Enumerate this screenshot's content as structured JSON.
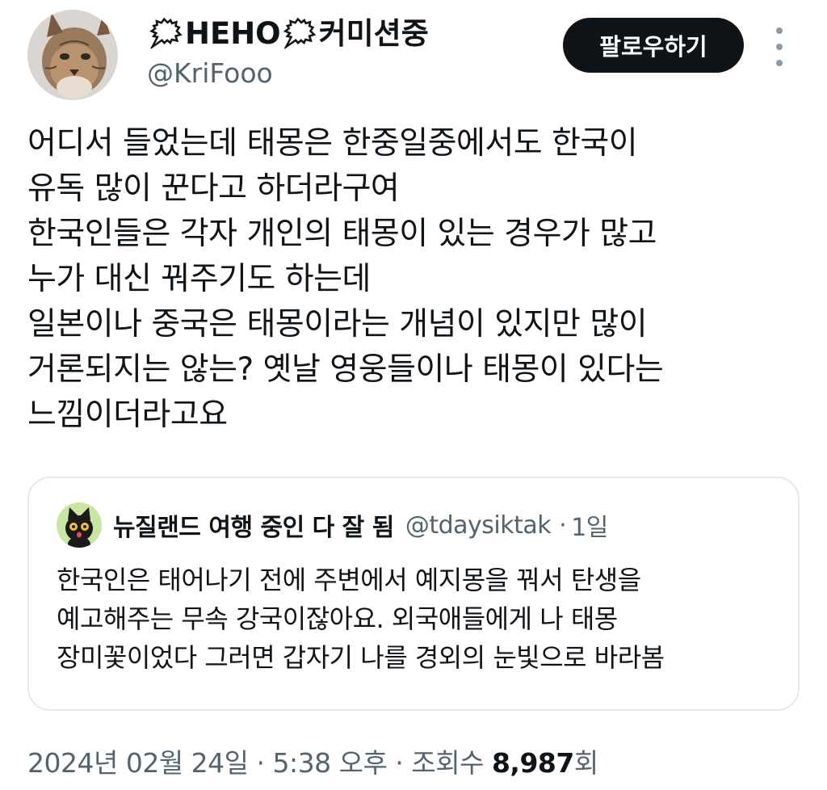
{
  "author": {
    "display_name": "🗯HEHO🗯커미션중",
    "handle": "@KriFooo",
    "avatar_icon": "lynx-avatar-icon"
  },
  "actions": {
    "follow_label": "팔로우하기",
    "more_icon": "more-vertical-icon"
  },
  "tweet": {
    "lines": [
      "어디서 들었는데 태몽은 한중일중에서도 한국이",
      "유독 많이 꾼다고 하더라구여",
      "한국인들은 각자 개인의 태몽이 있는 경우가 많고",
      "누가 대신 꿔주기도 하는데",
      "일본이나 중국은 태몽이라는 개념이 있지만 많이",
      "거론되지는 않는?  옛날 영웅들이나 태몽이 있다는",
      "느낌이더라고요"
    ]
  },
  "quoted_tweet": {
    "display_name": "뉴질랜드 여행 중인 다 잘 됨",
    "handle": "@tdaysiktak",
    "separator": "·",
    "time": "1일",
    "avatar_icon": "black-cat-avatar-icon",
    "lines": [
      "한국인은 태어나기 전에 주변에서 예지몽을 꿔서 탄생을",
      "예고해주는 무속 강국이잖아요. 외국애들에게 나 태몽",
      "장미꽃이었다 그러면 갑자기 나를 경외의 눈빛으로 바라봄"
    ]
  },
  "footer": {
    "date": "2024년 02월 24일",
    "separator1": "·",
    "time": "5:38 오후",
    "separator2": "·",
    "views_label": "조회수",
    "views_count": "8,987",
    "views_suffix": "회"
  },
  "colors": {
    "text_primary": "#0f1419",
    "text_secondary": "#536471",
    "button_bg": "#0f1419",
    "border": "#e5e9ec"
  }
}
